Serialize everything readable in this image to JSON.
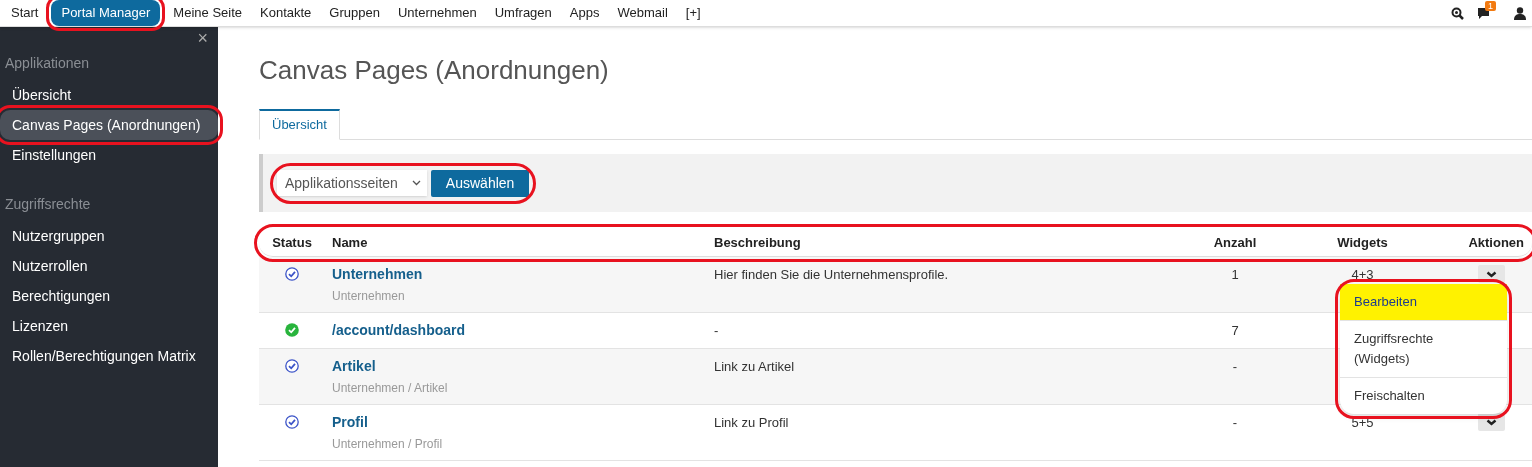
{
  "top_nav": {
    "items": [
      {
        "label": "Start",
        "selected": false,
        "annotated": false
      },
      {
        "label": "Portal Manager",
        "selected": true,
        "annotated": true
      },
      {
        "label": "Meine Seite",
        "selected": false,
        "annotated": false
      },
      {
        "label": "Kontakte",
        "selected": false,
        "annotated": false
      },
      {
        "label": "Gruppen",
        "selected": false,
        "annotated": false
      },
      {
        "label": "Unternehmen",
        "selected": false,
        "annotated": false
      },
      {
        "label": "Umfragen",
        "selected": false,
        "annotated": false
      },
      {
        "label": "Apps",
        "selected": false,
        "annotated": false
      },
      {
        "label": "Webmail",
        "selected": false,
        "annotated": false
      },
      {
        "label": "[+]",
        "selected": false,
        "annotated": false
      }
    ],
    "message_badge": "1"
  },
  "sidebar": {
    "close": "×",
    "sections": [
      {
        "title": "Applikationen",
        "items": [
          {
            "label": "Übersicht",
            "selected": false,
            "annotated": false
          },
          {
            "label": "Canvas Pages (Anordnungen)",
            "selected": true,
            "annotated": true
          },
          {
            "label": "Einstellungen",
            "selected": false,
            "annotated": false
          }
        ]
      },
      {
        "title": "Zugriffsrechte",
        "items": [
          {
            "label": "Nutzergruppen",
            "selected": false,
            "annotated": false
          },
          {
            "label": "Nutzerrollen",
            "selected": false,
            "annotated": false
          },
          {
            "label": "Berechtigungen",
            "selected": false,
            "annotated": false
          },
          {
            "label": "Lizenzen",
            "selected": false,
            "annotated": false
          },
          {
            "label": "Rollen/Berechtigungen Matrix",
            "selected": false,
            "annotated": false
          }
        ]
      }
    ]
  },
  "page": {
    "title": "Canvas Pages (Anordnungen)",
    "tabs": [
      {
        "label": "Übersicht",
        "selected": true
      }
    ],
    "filter": {
      "select_value": "Applikationsseiten",
      "button": "Auswählen",
      "annotated": true
    },
    "table": {
      "header_annotated": true,
      "columns": [
        "Status",
        "Name",
        "Beschreibung",
        "Anzahl",
        "Widgets",
        "Aktionen"
      ],
      "rows": [
        {
          "kind": "outline",
          "name": "Unternehmen",
          "path": "Unternehmen",
          "description": "Hier finden Sie die Unternehmensprofile.",
          "count": "1",
          "widgets": "4+3",
          "action_button": true
        },
        {
          "kind": "filled",
          "name": "/account/dashboard",
          "description": "-",
          "count": "7"
        },
        {
          "kind": "outline",
          "name": "Artikel",
          "path": "Unternehmen / Artikel",
          "description": "Link zu Artikel",
          "count": "-"
        },
        {
          "kind": "outline",
          "name": "Profil",
          "path": "Unternehmen / Profil",
          "description": "Link zu Profil",
          "count": "-",
          "widgets": "5+5",
          "action_button": true
        }
      ],
      "action_menu": {
        "annotated": true,
        "items": [
          {
            "label": "Bearbeiten",
            "selected": true
          },
          {
            "label": "Zugriffsrechte (Widgets)",
            "selected": false
          },
          {
            "label": "Freischalten",
            "selected": false
          }
        ]
      }
    }
  }
}
